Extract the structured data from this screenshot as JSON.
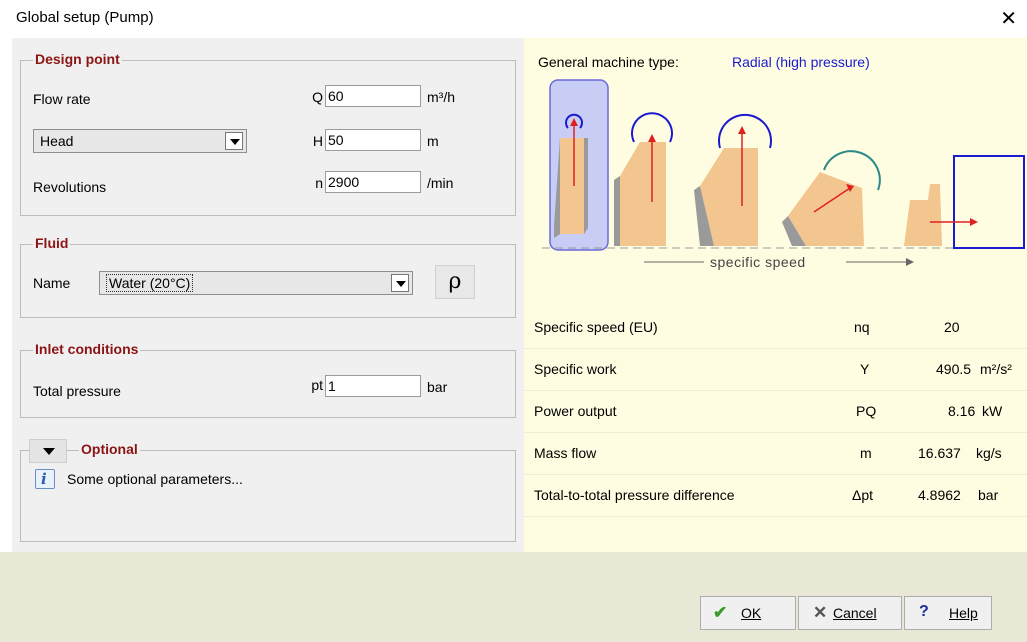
{
  "window": {
    "title": "Global setup (Pump)",
    "close_glyph": "✕"
  },
  "design_point": {
    "legend": "Design point",
    "flow_rate": {
      "label": "Flow rate",
      "symbol": "Q",
      "value": "60",
      "unit": "m³/h"
    },
    "head": {
      "selected": "Head",
      "symbol": "H",
      "value": "50",
      "unit": "m"
    },
    "revolutions": {
      "label": "Revolutions",
      "symbol": "n",
      "value": "2900",
      "unit": "/min"
    }
  },
  "fluid": {
    "legend": "Fluid",
    "name_label": "Name",
    "selected": "Water (20°C)",
    "rho_button": "ρ"
  },
  "inlet": {
    "legend": "Inlet conditions",
    "label": "Total pressure",
    "symbol": "pt",
    "value": "1",
    "unit": "bar"
  },
  "optional": {
    "legend": "Optional",
    "info_text": "Some optional parameters..."
  },
  "machine": {
    "label": "General machine type:",
    "type": "Radial (high pressure)",
    "axis_label": "specific speed",
    "accent_color": "#1a1ad0",
    "highlight_color": "#c8cdf5"
  },
  "results": [
    {
      "name": "Specific speed (EU)",
      "symbol": "nq",
      "value": "20",
      "unit": ""
    },
    {
      "name": "Specific work",
      "symbol": "Y",
      "value": "490.5",
      "unit": "m²/s²"
    },
    {
      "name": "Power output",
      "symbol": "PQ",
      "value": "8.16",
      "unit": "kW"
    },
    {
      "name": "Mass flow",
      "symbol": "m",
      "value": "16.637",
      "unit": "kg/s"
    },
    {
      "name": "Total-to-total pressure difference",
      "symbol": "Δpt",
      "value": "4.8962",
      "unit": "bar"
    }
  ],
  "buttons": {
    "ok": "OK",
    "cancel": "Cancel",
    "help": "Help"
  }
}
